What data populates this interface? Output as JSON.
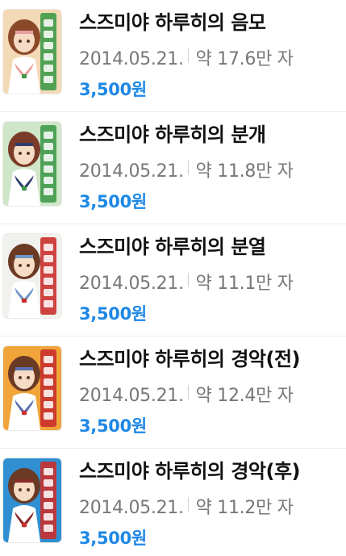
{
  "books": [
    {
      "title": "스즈미야 하루히의 음모",
      "date": "2014.05.21.",
      "length": "약 17.6만 자",
      "price": "3,500원",
      "cover": {
        "bg": "#f3d9b6",
        "accent": "#3f9a4a",
        "hair": "#8a4a2a",
        "skin": "#f6dcc4",
        "band": "#e9a0a0"
      }
    },
    {
      "title": "스즈미야 하루히의 분개",
      "date": "2014.05.21.",
      "length": "약 11.8만 자",
      "price": "3,500원",
      "cover": {
        "bg": "#cfe6c8",
        "accent": "#3f9a4a",
        "hair": "#7a3b28",
        "skin": "#f6dcc4",
        "band": "#2f3f6b"
      }
    },
    {
      "title": "스즈미야 하루히의 분열",
      "date": "2014.05.21.",
      "length": "약 11.1만 자",
      "price": "3,500원",
      "cover": {
        "bg": "#f1f1ee",
        "accent": "#c9302c",
        "hair": "#6b3a25",
        "skin": "#f6dcc4",
        "band": "#6f94c8"
      }
    },
    {
      "title": "스즈미야 하루히의 경악(전)",
      "date": "2014.05.21.",
      "length": "약 12.4만 자",
      "price": "3,500원",
      "cover": {
        "bg": "#f0a43a",
        "accent": "#c9302c",
        "hair": "#6b3a25",
        "skin": "#f6dcc4",
        "band": "#5a6fb0"
      }
    },
    {
      "title": "스즈미야 하루히의 경악(후)",
      "date": "2014.05.21.",
      "length": "약 11.2만 자",
      "price": "3,500원",
      "cover": {
        "bg": "#2f8fd0",
        "accent": "#c9302c",
        "hair": "#6b3a25",
        "skin": "#f6dcc4",
        "band": "#8b2a2a"
      }
    }
  ]
}
